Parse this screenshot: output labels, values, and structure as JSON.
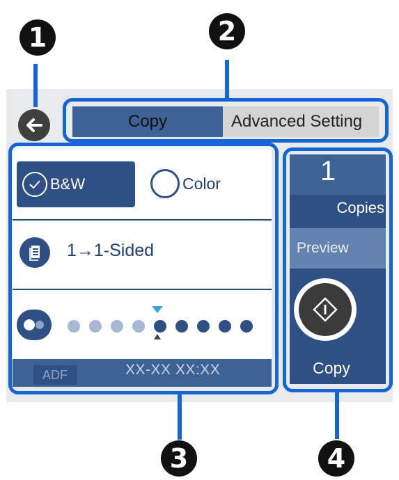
{
  "callouts": {
    "one": "1",
    "two": "2",
    "three": "3",
    "four": "4"
  },
  "tabs": {
    "copy": "Copy",
    "advanced": "Advanced Setting"
  },
  "color_mode": {
    "bw_label": "B&W",
    "color_label": "Color",
    "selected": "B&W"
  },
  "sided": {
    "label": "1→1-Sided"
  },
  "density": {
    "levels": 9,
    "selected_index": 4
  },
  "status_bar": {
    "source": "ADF",
    "datetime": "XX-XX  XX:XX"
  },
  "right_panel": {
    "copies_value": "1",
    "copies_label": "Copies",
    "preview_label": "Preview",
    "copy_label": "Copy"
  },
  "colors": {
    "accent": "#1565d8",
    "panel_dark": "#2f5084",
    "panel_mid": "#3d6296",
    "indicator": "#3aa3d6"
  }
}
